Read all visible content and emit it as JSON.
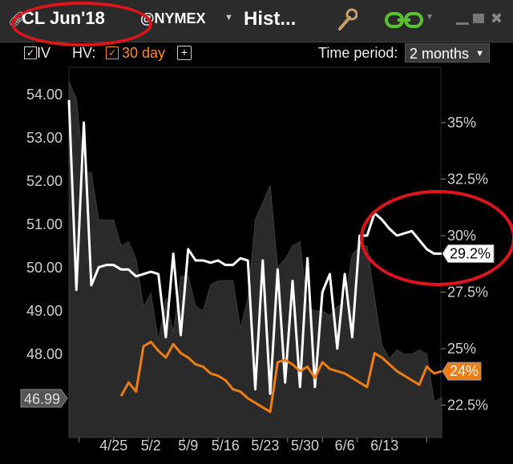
{
  "titlebar": {
    "symbol": "CL Jun'18",
    "exchange": "@NYMEX",
    "title": "Hist..."
  },
  "toolbar": {
    "iv_label": "IV",
    "iv_checked": true,
    "hv_label": "HV:",
    "hv_checked": true,
    "hv_period": "30 day",
    "add_label": "+",
    "time_period_label": "Time period:",
    "time_period_value": "2 months"
  },
  "colors": {
    "iv_line": "#ffffff",
    "hv_line": "#f07c14",
    "price_area": "#2a2a2a",
    "annotation": "#e0141b"
  },
  "chart_data": {
    "type": "line",
    "x_ticks": [
      "4/25",
      "5/2",
      "5/9",
      "5/16",
      "5/23",
      "5/30",
      "6/6",
      "6/13"
    ],
    "left_axis": {
      "ticks": [
        "54.00",
        "53.00",
        "52.00",
        "51.00",
        "50.00",
        "49.00",
        "48.00"
      ],
      "ylim": [
        46.4,
        54.3
      ]
    },
    "right_axis": {
      "ticks": [
        "35%",
        "32.5%",
        "30%",
        "27.5%",
        "25%",
        "22.5%"
      ],
      "ylim": [
        22.0,
        36.7
      ]
    },
    "price_marker": "46.99",
    "iv_marker": "29.2%",
    "hv_marker": "24%",
    "series": [
      {
        "name": "IV",
        "axis": "right",
        "x": [
          0,
          1.5,
          3,
          4.5,
          6,
          7.5,
          9,
          10.5,
          12,
          13.5,
          15,
          16.5,
          18,
          19.5,
          21,
          22.5,
          24,
          25.5,
          27,
          28.5,
          30,
          31.5,
          33,
          34.5,
          36,
          37.5,
          39,
          40.5,
          42,
          43.5,
          45,
          46.5,
          48,
          49.5,
          51,
          52.5,
          54,
          55.5,
          57,
          58.5,
          60,
          61.5,
          63,
          64.5,
          66,
          67.5,
          69,
          70.5,
          72,
          73.5,
          75
        ],
        "values": [
          36.0,
          27.6,
          35.0,
          27.8,
          28.6,
          28.7,
          28.7,
          28.5,
          28.5,
          28.2,
          28.3,
          28.4,
          28.3,
          25.5,
          29.2,
          25.6,
          29.4,
          28.9,
          28.9,
          28.8,
          28.9,
          28.7,
          28.7,
          29.0,
          28.9,
          23.2,
          28.9,
          23.0,
          28.5,
          23.5,
          28.0,
          23.3,
          29.0,
          23.3,
          27.5,
          28.3,
          25.0,
          28.3,
          25.5,
          30.0,
          30.0,
          31.0,
          30.7,
          30.3,
          30.0,
          30.1,
          30.2,
          29.8,
          29.4,
          29.2,
          29.2
        ],
        "last": 29.2
      },
      {
        "name": "HV 30 day",
        "axis": "right",
        "x": [
          10.5,
          12,
          13.5,
          15,
          16.5,
          18,
          19.5,
          21,
          22.5,
          24,
          25.5,
          27,
          28.5,
          30,
          31.5,
          33,
          34.5,
          36,
          37.5,
          39,
          40.5,
          42,
          43.5,
          45,
          46.5,
          48,
          49.5,
          51,
          52.5,
          54,
          55.5,
          57,
          58.5,
          60,
          61.5,
          63,
          64.5,
          66,
          67.5,
          69,
          70.5,
          72,
          73.5,
          75
        ],
        "values": [
          22.9,
          23.5,
          23.1,
          25.1,
          25.3,
          24.9,
          24.6,
          25.2,
          24.8,
          24.6,
          24.3,
          24.2,
          23.9,
          23.8,
          23.6,
          23.2,
          23.1,
          22.8,
          22.6,
          22.4,
          22.2,
          24.4,
          24.5,
          24.3,
          24.0,
          24.2,
          23.7,
          24.4,
          24.1,
          24.0,
          23.9,
          23.7,
          23.5,
          23.3,
          24.8,
          24.6,
          24.3,
          24.0,
          23.8,
          23.6,
          23.4,
          24.2,
          23.9,
          24.0
        ],
        "last": 24.0
      },
      {
        "name": "Price",
        "axis": "left",
        "style": "area",
        "x": [
          0,
          1.5,
          3,
          4.5,
          6,
          7.5,
          9,
          10.5,
          12,
          13.5,
          15,
          16.5,
          18,
          19.5,
          21,
          22.5,
          24,
          25.5,
          27,
          28.5,
          30,
          31.5,
          33,
          34.5,
          36,
          37.5,
          39,
          40.5,
          42,
          43.5,
          45,
          46.5,
          48,
          49.5,
          51,
          52.5,
          54,
          55.5,
          57,
          58.5,
          60,
          61.5,
          63,
          64.5,
          66,
          67.5,
          69,
          70.5,
          72,
          73.5,
          75
        ],
        "values": [
          54.3,
          53.9,
          52.2,
          52.2,
          51.1,
          51.1,
          51.1,
          50.5,
          50.6,
          50.2,
          49.1,
          49.4,
          48.3,
          49.3,
          48.5,
          49.8,
          49.8,
          49.1,
          49.0,
          49.6,
          49.7,
          49.7,
          49.7,
          48.6,
          49.3,
          51.1,
          51.5,
          51.9,
          50.0,
          50.2,
          50.5,
          50.6,
          49.1,
          49.0,
          49.0,
          48.9,
          49.1,
          49.2,
          50.3,
          50.5,
          50.5,
          49.3,
          48.2,
          47.9,
          48.1,
          48.0,
          48.0,
          48.1,
          48.0,
          46.9,
          47.0
        ],
        "last": 46.99
      }
    ]
  }
}
